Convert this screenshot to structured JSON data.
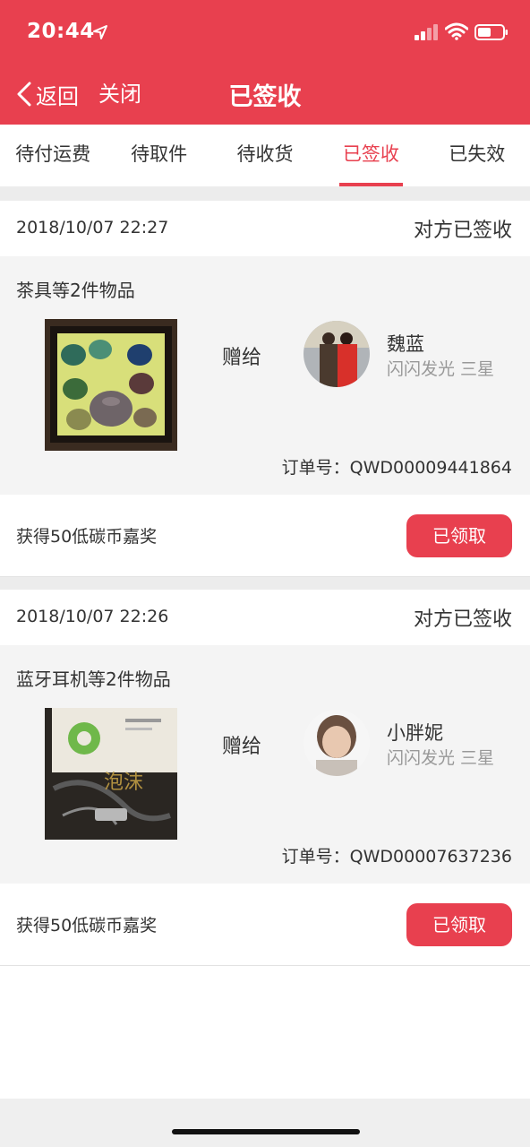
{
  "status_bar": {
    "time": "20:44"
  },
  "nav": {
    "back_label": "返回",
    "close_label": "关闭",
    "title": "已签收"
  },
  "tabs": [
    {
      "label": "待付运费",
      "active": false
    },
    {
      "label": "待取件",
      "active": false
    },
    {
      "label": "待收货",
      "active": false
    },
    {
      "label": "已签收",
      "active": true
    },
    {
      "label": "已失效",
      "active": false
    }
  ],
  "orders": [
    {
      "date": "2018/10/07 22:27",
      "status": "对方已签收",
      "title": "茶具等2件物品",
      "give_label": "赠给",
      "recipient_name": "魏蓝",
      "recipient_level": "闪闪发光 三星",
      "order_no": "订单号：QWD00009441864",
      "reward": "获得50低碳币嘉奖",
      "button": "已领取"
    },
    {
      "date": "2018/10/07 22:26",
      "status": "对方已签收",
      "title": "蓝牙耳机等2件物品",
      "give_label": "赠给",
      "recipient_name": "小胖妮",
      "recipient_level": "闪闪发光 三星",
      "order_no": "订单号：QWD00007637236",
      "reward": "获得50低碳币嘉奖",
      "button": "已领取"
    }
  ],
  "colors": {
    "accent": "#e8404f",
    "background_gray": "#ececec",
    "card_gray": "#f4f4f4"
  }
}
